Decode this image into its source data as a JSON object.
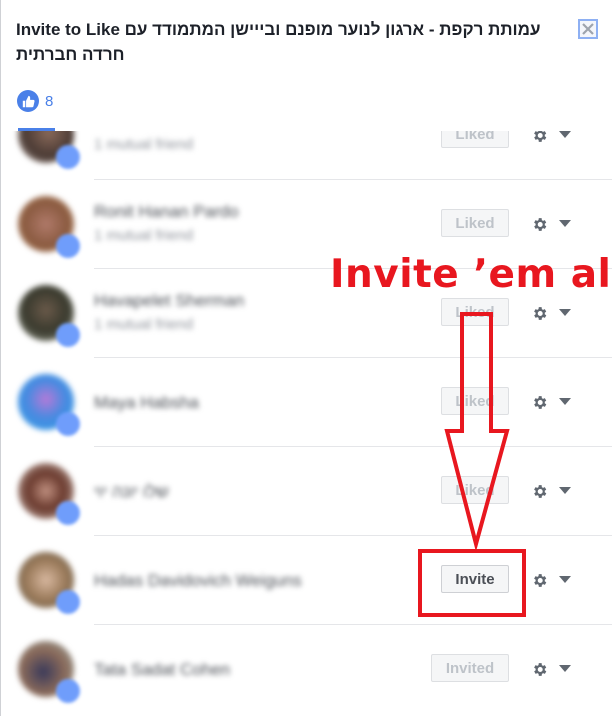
{
  "dialog": {
    "title": "עמותת רקפת - ארגון לנוער מופנם ובייישן המתמודד עם חרדה חברתית Invite to Like",
    "title_line1_hebrew": "עמותת רקפת - ארגון לנוער מופנם ובייישן המתמודד עם",
    "title_line1_english": "Invite to Like",
    "title_line2": "חרדה חברתית",
    "close_icon": "close-icon",
    "like_icon": "thumbs-up-icon",
    "like_count": "8"
  },
  "annotation": {
    "text": "Invite ’em all",
    "color": "#e8171f"
  },
  "friends": [
    {
      "name": "",
      "subtitle": "1 mutual friend",
      "action": "Liked",
      "state": "liked"
    },
    {
      "name": "Ronit Hanan Pardo",
      "subtitle": "1 mutual friend",
      "action": "Liked",
      "state": "liked"
    },
    {
      "name": "Havapelet Sherman",
      "subtitle": "1 mutual friend",
      "action": "Liked",
      "state": "liked"
    },
    {
      "name": "Maya Habsha",
      "subtitle": "",
      "action": "Liked",
      "state": "liked"
    },
    {
      "name": "שלו יונה יוי",
      "subtitle": "",
      "action": "Liked",
      "state": "liked"
    },
    {
      "name": "Hadas Davidovich Weiguns",
      "subtitle": "",
      "action": "Invite",
      "state": "invite"
    },
    {
      "name": "Tata Sadat Cohen",
      "subtitle": "",
      "action": "Invited",
      "state": "invited"
    }
  ],
  "colors": {
    "accent": "#4a80e8",
    "annotation_red": "#e8171f"
  }
}
